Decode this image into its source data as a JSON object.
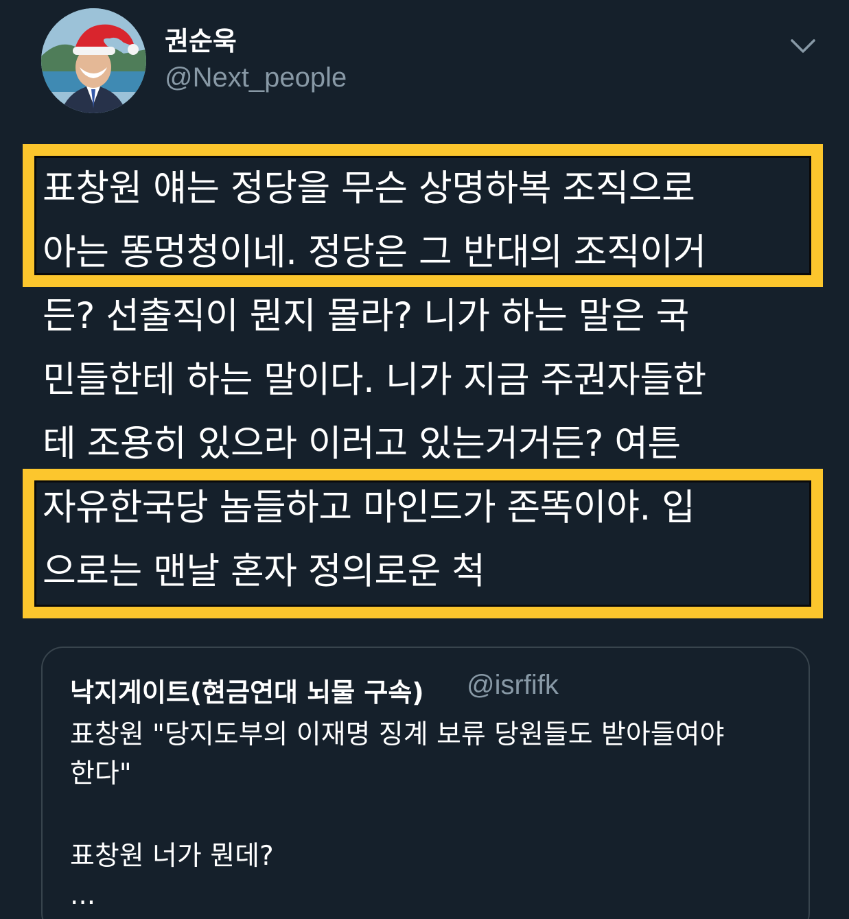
{
  "author": {
    "display_name": "권순욱",
    "handle": "@Next_people"
  },
  "tweet": {
    "lines": [
      "표창원 얘는 정당을 무슨 상명하복 조직으로",
      "아는 똥멍청이네. 정당은 그 반대의 조직이거",
      "든? 선출직이 뭔지 몰라? 니가 하는 말은 국",
      "민들한테 하는 말이다. 니가 지금 주권자들한",
      "테 조용히 있으라 이러고 있는거거든? 여튼",
      "자유한국당 놈들하고 마인드가 존똑이야. 입",
      "으로는 맨날 혼자 정의로운 척"
    ]
  },
  "quoted_tweet": {
    "display_name": "낙지게이트(현금연대 뇌물 구속)",
    "handle": "@isrfifk",
    "lines": [
      "표창원 \"당지도부의 이재명 징계 보류 당원들도 받아들여야",
      "한다\"",
      "표창원 너가 뭔데?",
      "..."
    ]
  },
  "colors": {
    "background": "#15202b",
    "highlight": "#fcc62d",
    "secondary_text": "#8899a6",
    "card_border": "#38444d"
  },
  "icons": {
    "menu": "chevron-down-icon"
  }
}
